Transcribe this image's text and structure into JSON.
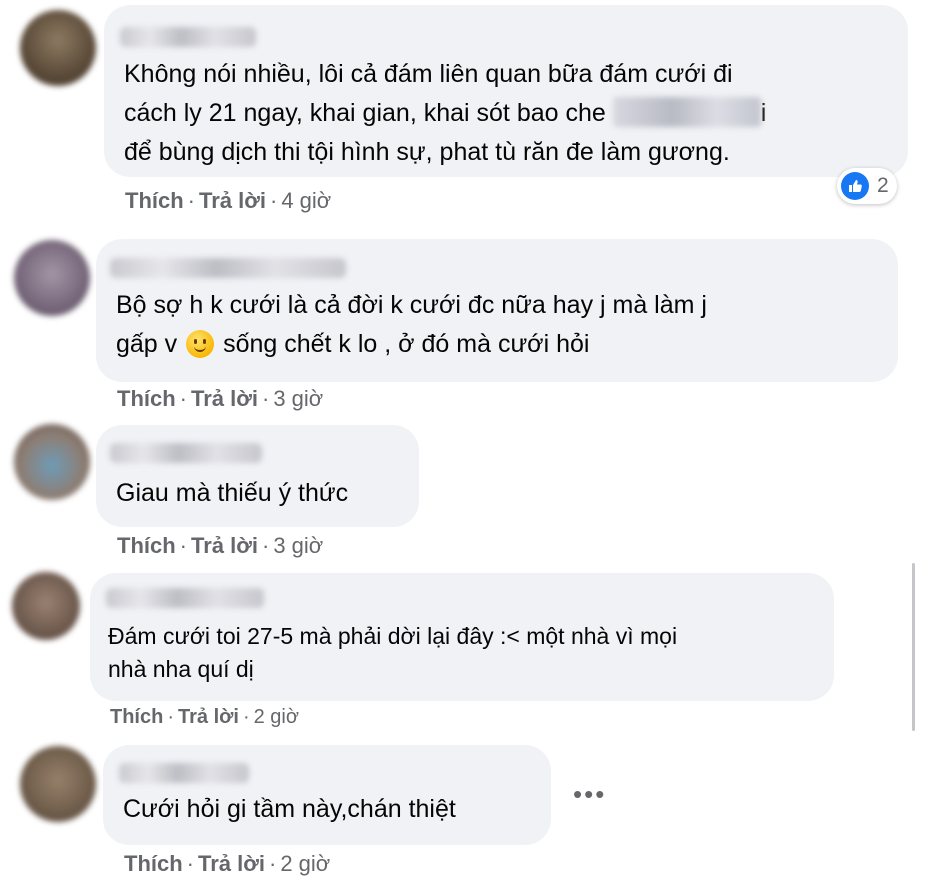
{
  "comments": [
    {
      "lines": [
        "Không nói nhiều, lôi cả đám liên quan bữa đám cưới đi",
        "cách ly 21 ngay, khai gian, khai sót bao che",
        "để bùng dịch thi tội hình sự, phat tù răn đe làm gương."
      ],
      "line2_tail": "i",
      "like": "Thích",
      "reply": "Trả lời",
      "time": "4 giờ",
      "reaction_count": "2"
    },
    {
      "line1": "Bộ sợ h k cưới là cả đời k cưới đc nữa hay j mà làm j",
      "line2a": "gấp v",
      "line2b": "sống chết k lo , ở đó mà cưới hỏi",
      "like": "Thích",
      "reply": "Trả lời",
      "time": "3 giờ"
    },
    {
      "text": "Giau mà thiếu ý thức",
      "like": "Thích",
      "reply": "Trả lời",
      "time": "3 giờ"
    },
    {
      "lines": [
        "Đám cưới toi 27-5 mà phải dời lại đây :< một nhà vì mọi",
        "nhà nha quí dị"
      ],
      "like": "Thích",
      "reply": "Trả lời",
      "time": "2 giờ"
    },
    {
      "text": "Cưới hỏi gi tầm này,chán thiệt",
      "like": "Thích",
      "reply": "Trả lời",
      "time": "2 giờ",
      "more": "•••"
    }
  ],
  "colors": {
    "bubble": "#f0f2f5",
    "meta": "#65676b",
    "like_blue": "#1877f2"
  }
}
